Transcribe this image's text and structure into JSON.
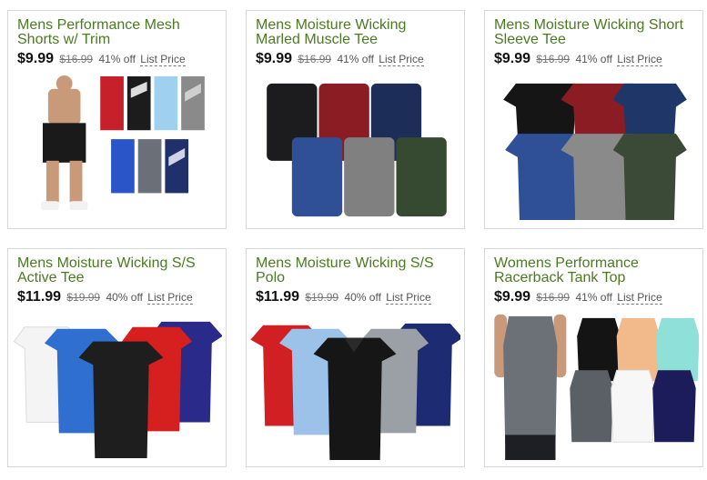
{
  "products": [
    {
      "title_line1": "Mens Performance Mesh",
      "title_line2": "Shorts w/ Trim",
      "price": "$9.99",
      "original_price": "$16.99",
      "discount": "41% off",
      "list_label": "List Price"
    },
    {
      "title_line1": "Mens Moisture Wicking",
      "title_line2": "Marled Muscle Tee",
      "price": "$9.99",
      "original_price": "$16.99",
      "discount": "41% off",
      "list_label": "List Price"
    },
    {
      "title_line1": "Mens Moisture Wicking Short",
      "title_line2": "Sleeve Tee",
      "price": "$9.99",
      "original_price": "$16.99",
      "discount": "41% off",
      "list_label": "List Price"
    },
    {
      "title_line1": "Mens Moisture Wicking S/S",
      "title_line2": "Active Tee",
      "price": "$11.99",
      "original_price": "$19.99",
      "discount": "40% off",
      "list_label": "List Price"
    },
    {
      "title_line1": "Mens Moisture Wicking S/S",
      "title_line2": "Polo",
      "price": "$11.99",
      "original_price": "$19.99",
      "discount": "40% off",
      "list_label": "List Price"
    },
    {
      "title_line1": "Womens Performance",
      "title_line2": "Racerback Tank Top",
      "price": "$9.99",
      "original_price": "$16.99",
      "discount": "41% off",
      "list_label": "List Price"
    }
  ],
  "colors": {
    "title_green": "#4a7a22",
    "border": "#d8d8d8"
  }
}
